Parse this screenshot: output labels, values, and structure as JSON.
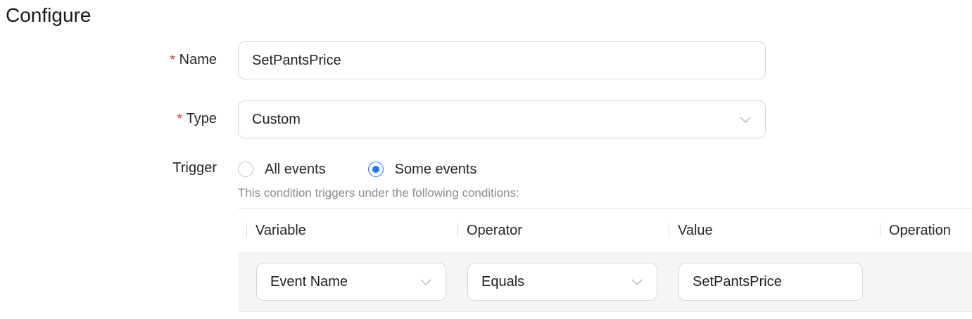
{
  "page": {
    "title": "Configure"
  },
  "form": {
    "name": {
      "label": "Name",
      "required_mark": "*",
      "value": "SetPantsPrice"
    },
    "type": {
      "label": "Type",
      "required_mark": "*",
      "value": "Custom"
    },
    "trigger": {
      "label": "Trigger",
      "options": [
        "All events",
        "Some events"
      ],
      "selected": "Some events",
      "hint": "This condition triggers under the following conditions:"
    }
  },
  "conditions_table": {
    "columns": [
      "Variable",
      "Operator",
      "Value",
      "Operation"
    ],
    "rows": [
      {
        "variable": "Event Name",
        "operator": "Equals",
        "value": "SetPantsPrice"
      }
    ]
  },
  "colors": {
    "accent": "#1677ff",
    "required": "#e02424",
    "row_bg": "#f5f5f5"
  },
  "icons": {
    "select_arrow": "chevron-down-icon"
  }
}
